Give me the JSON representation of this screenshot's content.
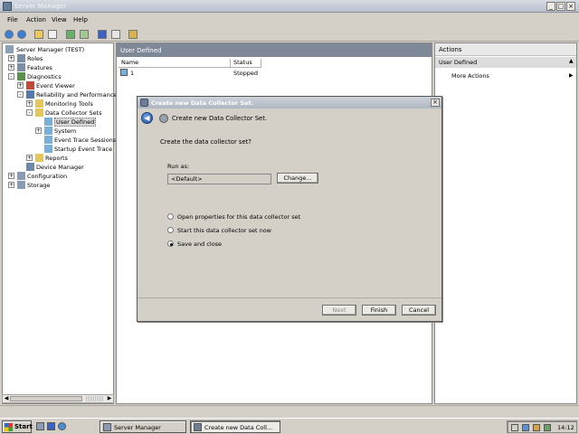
{
  "window": {
    "title": "Server Manager"
  },
  "menu": [
    "File",
    "Action",
    "View",
    "Help"
  ],
  "tree": [
    {
      "label": "Server Manager (TEST)",
      "expander": ""
    },
    {
      "label": "Roles",
      "expander": "+"
    },
    {
      "label": "Features",
      "expander": "+"
    },
    {
      "label": "Diagnostics",
      "expander": "-"
    },
    {
      "label": "Event Viewer",
      "expander": "+"
    },
    {
      "label": "Reliability and Performance",
      "expander": "-"
    },
    {
      "label": "Monitoring Tools",
      "expander": "+"
    },
    {
      "label": "Data Collector Sets",
      "expander": "-"
    },
    {
      "label": "User Defined",
      "expander": ""
    },
    {
      "label": "System",
      "expander": "+"
    },
    {
      "label": "Event Trace Sessions",
      "expander": ""
    },
    {
      "label": "Startup Event Trace",
      "expander": ""
    },
    {
      "label": "Reports",
      "expander": "+"
    },
    {
      "label": "Device Manager",
      "expander": ""
    },
    {
      "label": "Configuration",
      "expander": "+"
    },
    {
      "label": "Storage",
      "expander": "+"
    }
  ],
  "content": {
    "header": "User Defined",
    "columns": [
      "Name",
      "Status"
    ],
    "rows": [
      {
        "name": "1",
        "status": "Stopped"
      }
    ]
  },
  "actions": {
    "title": "Actions",
    "section": "User Defined",
    "items": [
      "More Actions"
    ]
  },
  "dialog": {
    "title": "Create new Data Collector Set.",
    "heading": "Create new Data Collector Set.",
    "question": "Create the data collector set?",
    "run_as_label": "Run as:",
    "run_as_value": "<Default>",
    "change_button": "Change...",
    "options": [
      {
        "label": "Open properties for this data collector set",
        "checked": false
      },
      {
        "label": "Start this data collector set now",
        "checked": false
      },
      {
        "label": "Save and close",
        "checked": true
      }
    ],
    "buttons": {
      "next": "Next",
      "finish": "Finish",
      "cancel": "Cancel"
    }
  },
  "taskbar": {
    "start": "Start",
    "tasks": [
      {
        "label": "Server Manager",
        "active": false
      },
      {
        "label": "Create new Data Coll...",
        "active": true
      }
    ],
    "clock": "14:12"
  }
}
